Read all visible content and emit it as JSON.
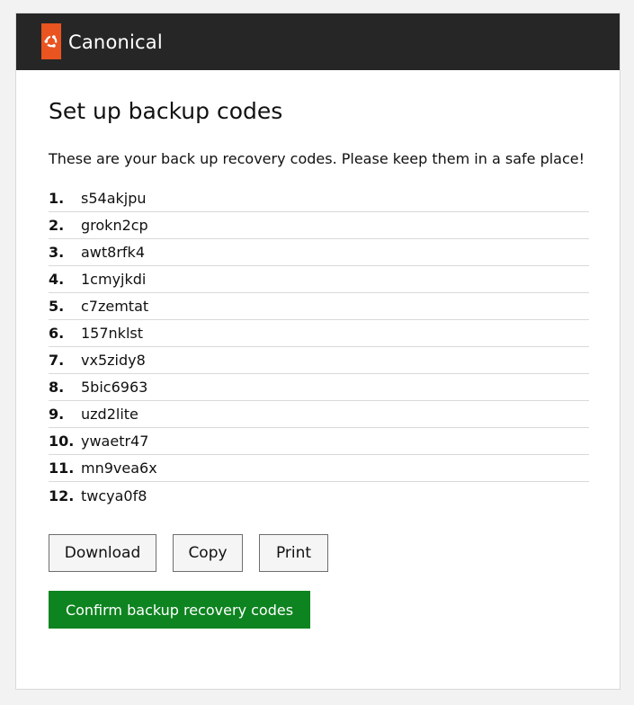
{
  "header": {
    "brand": "Canonical",
    "logo_icon": "canonical-circle-of-friends-icon",
    "colors": {
      "bar": "#262626",
      "logo_tile": "#e95420"
    }
  },
  "main": {
    "title": "Set up backup codes",
    "intro": "These are your back up recovery codes. Please keep them in a safe place!",
    "codes": [
      {
        "num": "1.",
        "code": "s54akjpu"
      },
      {
        "num": "2.",
        "code": "grokn2cp"
      },
      {
        "num": "3.",
        "code": "awt8rfk4"
      },
      {
        "num": "4.",
        "code": "1cmyjkdi"
      },
      {
        "num": "5.",
        "code": "c7zemtat"
      },
      {
        "num": "6.",
        "code": "157nklst"
      },
      {
        "num": "7.",
        "code": "vx5zidy8"
      },
      {
        "num": "8.",
        "code": "5bic6963"
      },
      {
        "num": "9.",
        "code": "uzd2lite"
      },
      {
        "num": "10.",
        "code": "ywaetr47"
      },
      {
        "num": "11.",
        "code": "mn9vea6x"
      },
      {
        "num": "12.",
        "code": "twcya0f8"
      }
    ],
    "actions": {
      "download": "Download",
      "copy": "Copy",
      "print": "Print",
      "confirm": "Confirm backup recovery codes"
    },
    "colors": {
      "confirm": "#0e8420"
    }
  }
}
